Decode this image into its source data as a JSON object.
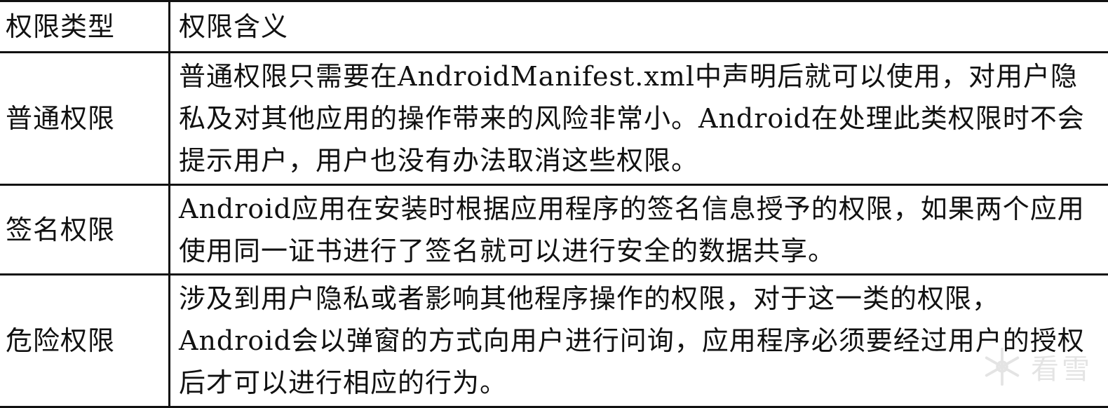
{
  "table": {
    "headers": [
      "权限类型",
      "权限含义"
    ],
    "rows": [
      {
        "type": "普通权限",
        "meaning": "普通权限只需要在AndroidManifest.xml中声明后就可以使用，对用户隐私及对其他应用的操作带来的风险非常小。Android在处理此类权限时不会提示用户，用户也没有办法取消这些权限。"
      },
      {
        "type": "签名权限",
        "meaning": "Android应用在安装时根据应用程序的签名信息授予的权限，如果两个应用使用同一证书进行了签名就可以进行安全的数据共享。"
      },
      {
        "type": "危险权限",
        "meaning": "涉及到用户隐私或者影响其他程序操作的权限，对于这一类的权限，Android会以弹窗的方式向用户进行问询，应用程序必须要经过用户的授权后才可以进行相应的行为。"
      }
    ]
  },
  "watermark": {
    "text": "看雪",
    "icon": "snowflake-logo-icon",
    "color": "#cfcfcf"
  }
}
